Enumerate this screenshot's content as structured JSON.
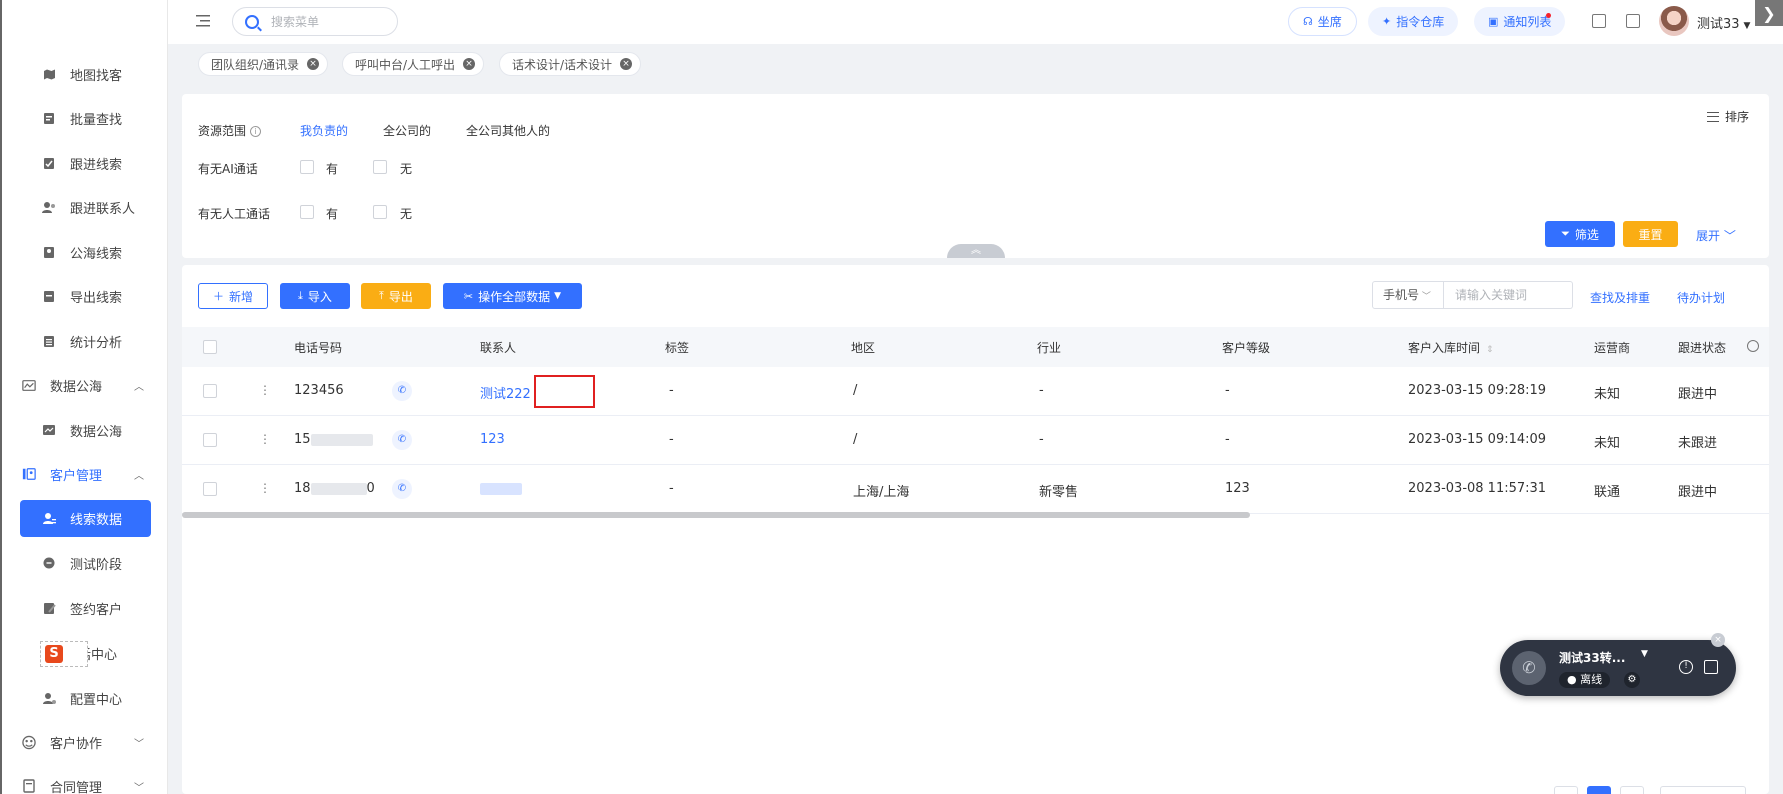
{
  "sidebar": {
    "items": [
      {
        "label": "地图找客",
        "icon": "map-icon"
      },
      {
        "label": "批量查找",
        "icon": "batch-search-icon"
      },
      {
        "label": "跟进线索",
        "icon": "follow-lead-icon"
      },
      {
        "label": "跟进联系人",
        "icon": "contact-icon"
      },
      {
        "label": "公海线索",
        "icon": "public-lead-icon"
      },
      {
        "label": "导出线索",
        "icon": "export-lead-icon"
      },
      {
        "label": "统计分析",
        "icon": "stats-icon"
      },
      {
        "label": "数据公海",
        "icon": "data-pool-icon",
        "group": true
      },
      {
        "label": "数据公海",
        "icon": "data-pool-sub-icon"
      },
      {
        "label": "客户管理",
        "icon": "customer-mgmt-icon",
        "group": true
      },
      {
        "label": "线索数据",
        "icon": "lead-data-icon"
      },
      {
        "label": "测试阶段",
        "icon": "test-stage-icon"
      },
      {
        "label": "签约客户",
        "icon": "signed-customer-icon"
      },
      {
        "label": "话中心",
        "icon": "call-center-icon"
      },
      {
        "label": "配置中心",
        "icon": "config-icon"
      },
      {
        "label": "客户协作",
        "icon": "collab-icon",
        "group": true
      },
      {
        "label": "合同管理",
        "icon": "contract-icon",
        "group": true
      }
    ]
  },
  "topbar": {
    "search_placeholder": "搜索菜单",
    "seat_label": "坐席",
    "command_label": "指令仓库",
    "notice_label": "通知列表",
    "username": "测试33"
  },
  "tags": [
    {
      "label": "团队组织/通讯录"
    },
    {
      "label": "呼叫中台/人工呼出"
    },
    {
      "label": "话术设计/话术设计"
    }
  ],
  "filters": {
    "scope_label": "资源范围",
    "scope_options": [
      "我负责的",
      "全公司的",
      "全公司其他人的"
    ],
    "ai_call_label": "有无AI通话",
    "human_call_label": "有无人工通话",
    "yes": "有",
    "no": "无",
    "sort_label": "排序",
    "filter_btn": "筛选",
    "reset_btn": "重置",
    "expand_label": "展开"
  },
  "toolbar": {
    "add_btn": "新增",
    "import_btn": "导入",
    "export_btn": "导出",
    "bulk_btn": "操作全部数据",
    "kw_select": "手机号",
    "kw_placeholder": "请输入关键词",
    "dedupe_link": "查找及排重",
    "todo_link": "待办计划"
  },
  "table": {
    "headers": [
      "电话号码",
      "联系人",
      "标签",
      "地区",
      "行业",
      "客户等级",
      "客户入库时间",
      "运营商",
      "跟进状态"
    ],
    "rows": [
      {
        "phone": "123456",
        "contact": "测试222",
        "tag": "-",
        "region": "/",
        "industry": "-",
        "level": "-",
        "time": "2023-03-15 09:28:19",
        "carrier": "未知",
        "status": "跟进中"
      },
      {
        "phone": "15",
        "phone_tail": "",
        "contact": "123",
        "tag": "-",
        "region": "/",
        "industry": "-",
        "level": "-",
        "time": "2023-03-15 09:14:09",
        "carrier": "未知",
        "status": "未跟进"
      },
      {
        "phone": "18",
        "phone_tail": "0",
        "contact": "",
        "tag": "-",
        "region": "上海/上海",
        "industry": "新零售",
        "level": "123",
        "time": "2023-03-08 11:57:31",
        "carrier": "联通",
        "status": "跟进中"
      }
    ]
  },
  "call_widget": {
    "name": "测试33转...",
    "status": "离线"
  },
  "colors": {
    "primary": "#3370ff",
    "warning": "#faad14",
    "highlight_box": "#e02020"
  }
}
